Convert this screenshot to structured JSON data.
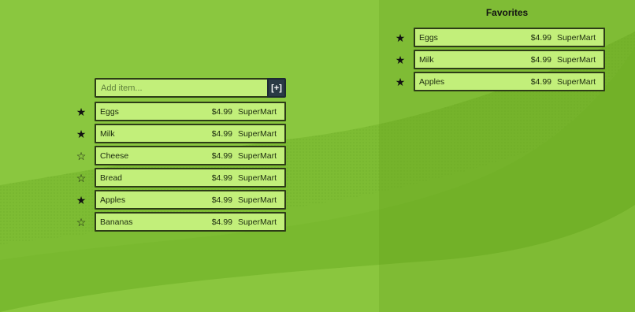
{
  "add_form": {
    "placeholder": "Add item...",
    "button_label": "[+]"
  },
  "items": [
    {
      "name": "Eggs",
      "price": "$4.99",
      "store": "SuperMart",
      "starred": true,
      "star_glyph": "★"
    },
    {
      "name": "Milk",
      "price": "$4.99",
      "store": "SuperMart",
      "starred": true,
      "star_glyph": "★"
    },
    {
      "name": "Cheese",
      "price": "$4.99",
      "store": "SuperMart",
      "starred": false,
      "star_glyph": "☆"
    },
    {
      "name": "Bread",
      "price": "$4.99",
      "store": "SuperMart",
      "starred": false,
      "star_glyph": "☆"
    },
    {
      "name": "Apples",
      "price": "$4.99",
      "store": "SuperMart",
      "starred": true,
      "star_glyph": "★"
    },
    {
      "name": "Bananas",
      "price": "$4.99",
      "store": "SuperMart",
      "starred": false,
      "star_glyph": "☆"
    }
  ],
  "favorites": {
    "title": "Favorites",
    "items": [
      {
        "name": "Eggs",
        "price": "$4.99",
        "store": "SuperMart",
        "starred": true,
        "star_glyph": "★"
      },
      {
        "name": "Milk",
        "price": "$4.99",
        "store": "SuperMart",
        "starred": true,
        "star_glyph": "★"
      },
      {
        "name": "Apples",
        "price": "$4.99",
        "store": "SuperMart",
        "starred": true,
        "star_glyph": "★"
      }
    ]
  },
  "colors": {
    "background": "#7fbd35",
    "item_fill": "#c2ef7a",
    "item_border": "#2d3c17",
    "add_button": "#2a3a45"
  },
  "icons": {
    "starred": "star-filled-icon",
    "unstarred": "star-outline-icon"
  }
}
